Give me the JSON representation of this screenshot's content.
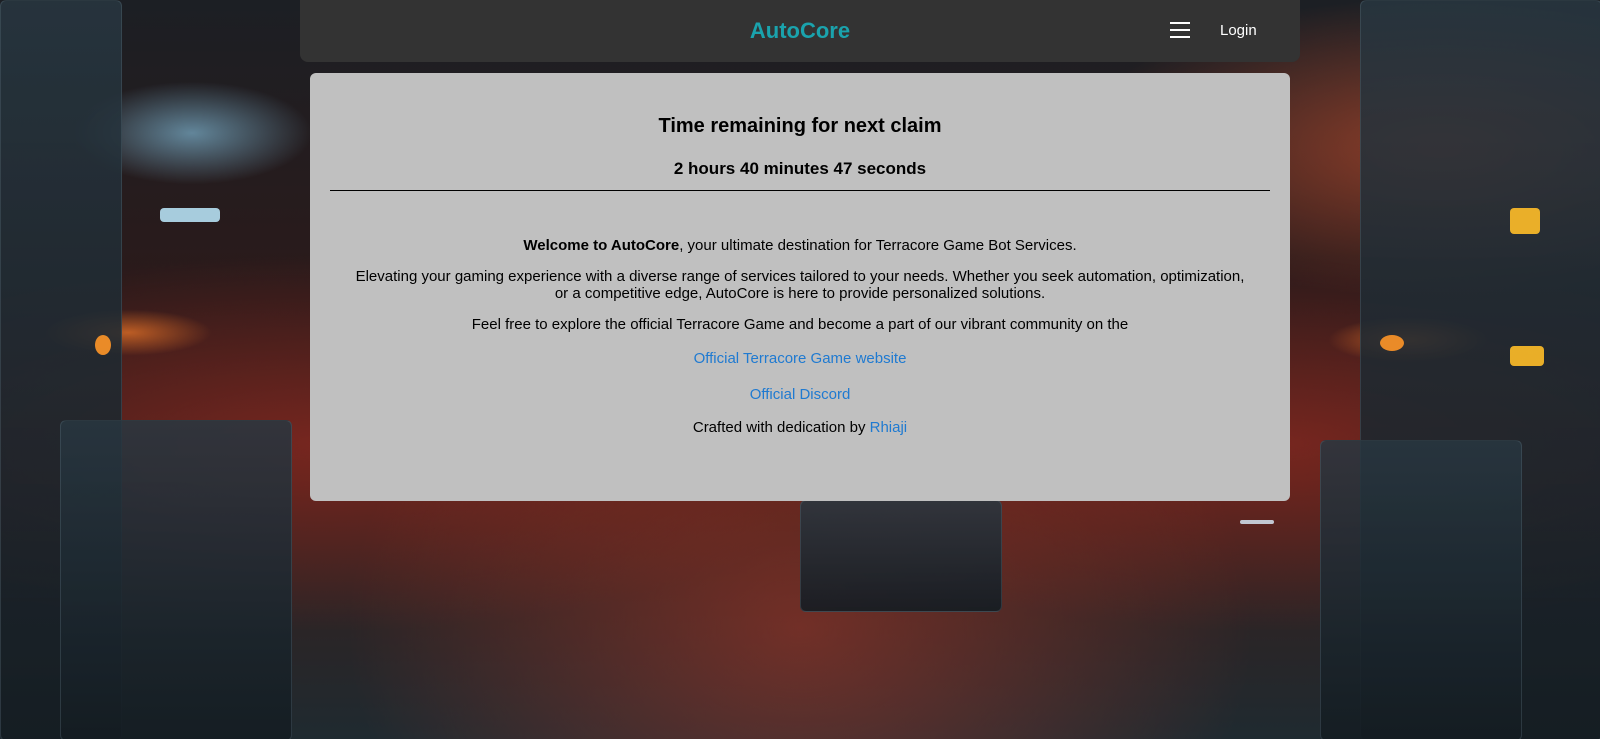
{
  "navbar": {
    "brand": "AutoCore",
    "menu_icon": "hamburger-menu-icon",
    "login_label": "Login",
    "brand_color": "#1aa3ad",
    "background_color": "#333333"
  },
  "timer": {
    "title": "Time remaining for next claim",
    "value": "2 hours 40 minutes 47 seconds"
  },
  "welcome": {
    "bold_text": "Welcome to AutoCore",
    "rest_text": ", your ultimate destination for Terracore Game Bot Services."
  },
  "description": "Elevating your gaming experience with a diverse range of services tailored to your needs. Whether you seek automation, optimization, or a competitive edge, AutoCore is here to provide personalized solutions.",
  "explore_text": "Feel free to explore the official Terracore Game and become a part of our vibrant community on the",
  "links": {
    "game_website": "Official Terracore Game website",
    "discord": "Official Discord",
    "link_color": "#1f7ad1"
  },
  "credits": {
    "prefix": "Crafted with dedication by ",
    "author": "Rhiaji"
  },
  "card": {
    "background_color": "#c0c0c0"
  }
}
